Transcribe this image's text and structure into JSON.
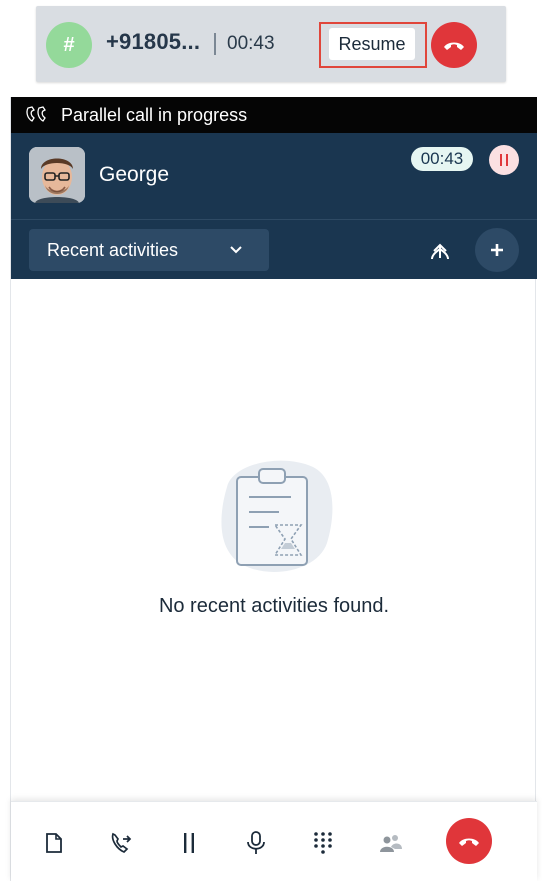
{
  "held_call": {
    "avatar_symbol": "#",
    "number": "+91805...",
    "timer": "00:43",
    "resume_label": "Resume",
    "hangup_icon": "hangup-icon",
    "avatar_color": "#94d99a",
    "highlight_color": "#e0463b"
  },
  "banner": {
    "icon": "parallel-call-icon",
    "text": "Parallel call in progress"
  },
  "contact": {
    "name": "George",
    "timer": "00:43",
    "hold_icon": "pause-icon"
  },
  "activities": {
    "dropdown_label": "Recent activities",
    "merge_icon": "merge-icon",
    "add_icon": "plus-icon"
  },
  "empty_state": {
    "icon": "clipboard-hourglass-icon",
    "message": "No recent activities found."
  },
  "toolbar": {
    "items": [
      "notes-icon",
      "transfer-icon",
      "hold-icon",
      "microphone-icon",
      "dialpad-icon",
      "conference-icon",
      "hangup-icon"
    ]
  },
  "colors": {
    "header_bg": "#1a3650",
    "banner_bg": "#050505",
    "hangup": "#e0363a",
    "timer_pill": "#e6f6f2"
  }
}
